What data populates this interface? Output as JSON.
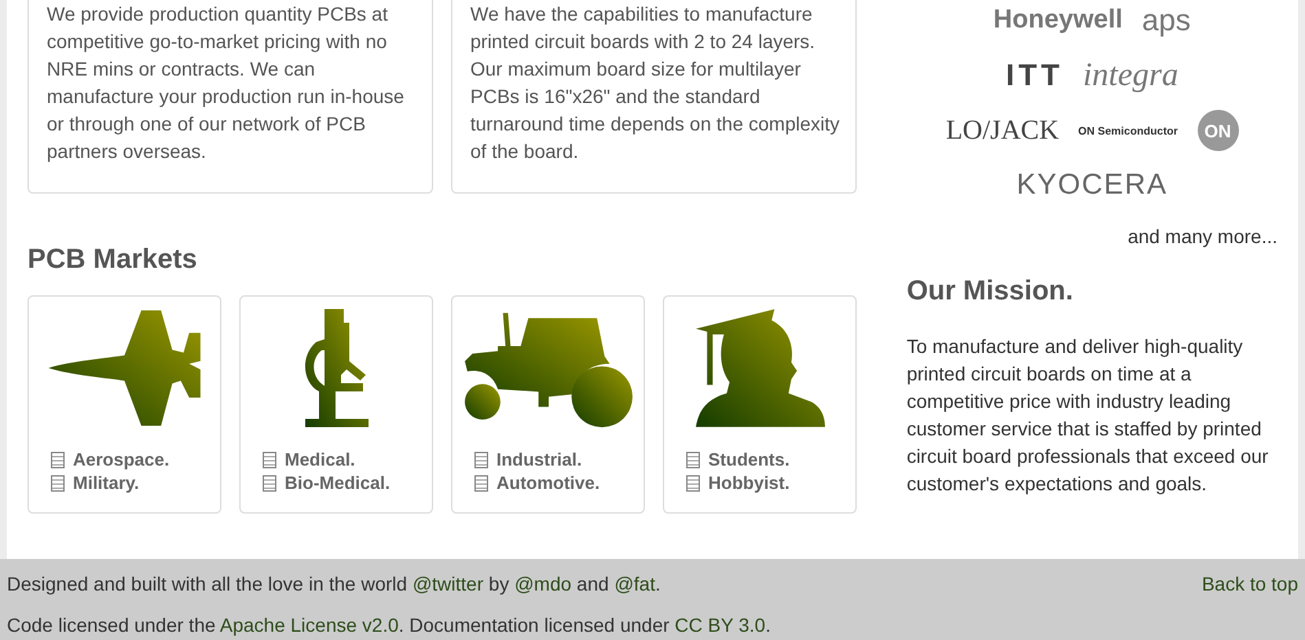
{
  "services": [
    {
      "text": "We provide production quantity PCBs at competitive go-to-market pricing with no NRE mins or contracts. We can manufacture your production run in-house or through one of our network of PCB partners overseas."
    },
    {
      "text": "We have the capabilities to manufacture printed circuit boards with 2 to 24 layers. Our maximum board size for multilayer PCBs is 16\"x26\" and the standard turnaround time depends on the complexity of the board."
    }
  ],
  "markets": {
    "title": "PCB Markets",
    "items": [
      {
        "kind": "jet",
        "labels": [
          "Aerospace.",
          "Military."
        ]
      },
      {
        "kind": "microscope",
        "labels": [
          "Medical.",
          "Bio-Medical."
        ]
      },
      {
        "kind": "tractor",
        "labels": [
          "Industrial.",
          "Automotive."
        ]
      },
      {
        "kind": "graduate",
        "labels": [
          "Students.",
          "Hobbyist."
        ]
      }
    ]
  },
  "clients": {
    "logos": [
      [
        "Honeywell",
        "aps"
      ],
      [
        "ITT",
        "integra"
      ],
      [
        "LO/JACK",
        "ON Semiconductor",
        "ON"
      ],
      [
        "KYOCERA"
      ]
    ],
    "more": "and many more..."
  },
  "mission": {
    "title": "Our Mission.",
    "text": "To manufacture and deliver high-quality printed circuit boards on time at a competitive price with industry leading customer service that is staffed by printed circuit board professionals that exceed our customer's expectations and goals."
  },
  "footer": {
    "lines": [
      [
        {
          "text": "Designed and built with all the love in the world ",
          "link": false
        },
        {
          "text": "@twitter",
          "link": true
        },
        {
          "text": " by ",
          "link": false
        },
        {
          "text": "@mdo",
          "link": true
        },
        {
          "text": " and ",
          "link": false
        },
        {
          "text": "@fat",
          "link": true
        },
        {
          "text": ".",
          "link": false
        }
      ],
      [
        {
          "text": "Code licensed under the ",
          "link": false
        },
        {
          "text": "Apache License v2.0",
          "link": true
        },
        {
          "text": ". Documentation licensed under ",
          "link": false
        },
        {
          "text": "CC BY 3.0",
          "link": true
        },
        {
          "text": ".",
          "link": false
        }
      ]
    ],
    "back": "Back to top"
  }
}
